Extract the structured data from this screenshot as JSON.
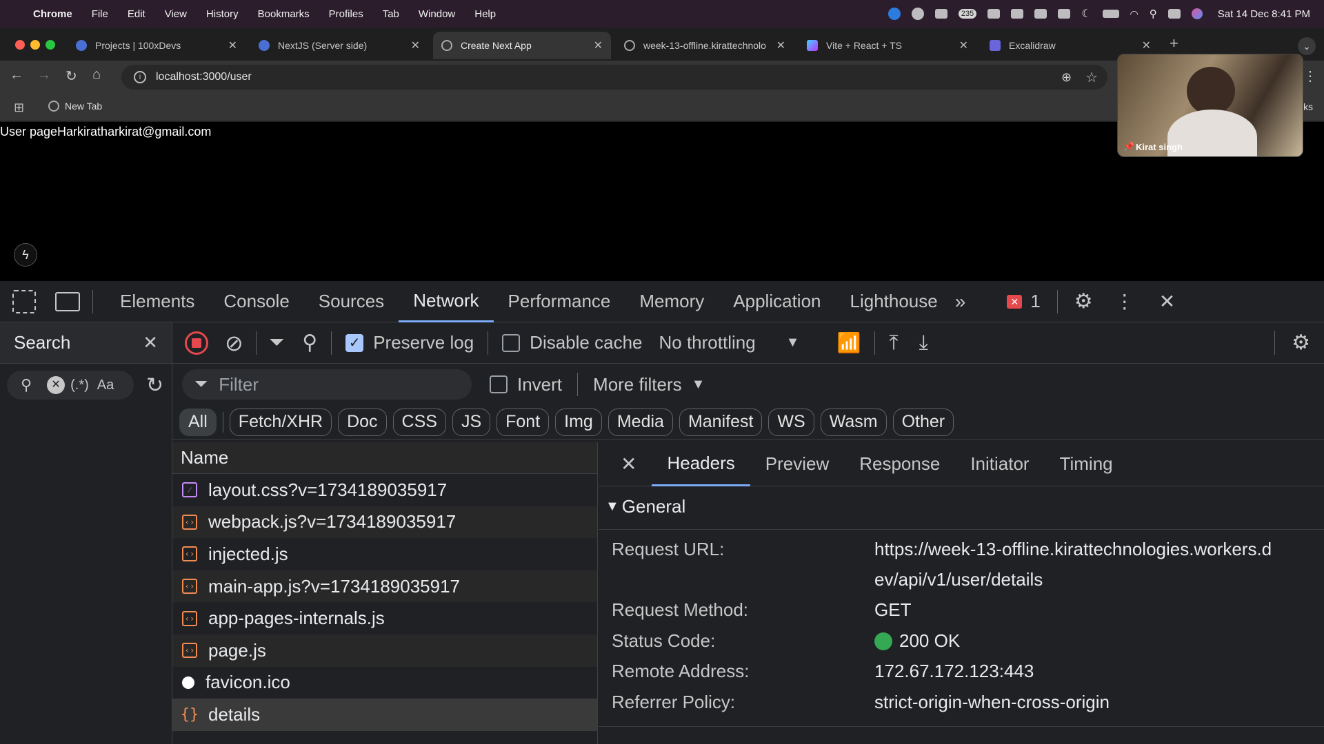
{
  "menubar": {
    "items": [
      "Chrome",
      "File",
      "Edit",
      "View",
      "History",
      "Bookmarks",
      "Profiles",
      "Tab",
      "Window",
      "Help"
    ],
    "badge_count": "235",
    "datetime": "Sat 14 Dec  8:41 PM"
  },
  "tabs": [
    {
      "title": "Projects | 100xDevs",
      "active": false
    },
    {
      "title": "NextJS (Server side)",
      "active": false
    },
    {
      "title": "Create Next App",
      "active": true
    },
    {
      "title": "week-13-offline.kirattechnolo",
      "active": false
    },
    {
      "title": "Vite + React + TS",
      "active": false
    },
    {
      "title": "Excalidraw",
      "active": false
    }
  ],
  "address": {
    "url": "localhost:3000/user"
  },
  "bookmarks": {
    "new_tab": "New Tab",
    "all_bookmarks": "ks"
  },
  "page": {
    "text": "User pageHarkiratharkirat@gmail.com"
  },
  "video": {
    "name": "Kirat singh"
  },
  "devtools": {
    "tabs": [
      "Elements",
      "Console",
      "Sources",
      "Network",
      "Performance",
      "Memory",
      "Application",
      "Lighthouse"
    ],
    "active_tab": "Network",
    "error_count": "1",
    "search_label": "Search",
    "search_regex": "(.*)",
    "search_case": "Aa",
    "preserve_log": "Preserve log",
    "disable_cache": "Disable cache",
    "throttling": "No throttling",
    "filter_placeholder": "Filter",
    "invert": "Invert",
    "more_filters": "More filters",
    "chips": [
      "All",
      "Fetch/XHR",
      "Doc",
      "CSS",
      "JS",
      "Font",
      "Img",
      "Media",
      "Manifest",
      "WS",
      "Wasm",
      "Other"
    ],
    "name_header": "Name",
    "requests": [
      {
        "name": "layout.css?v=1734189035917",
        "type": "css"
      },
      {
        "name": "webpack.js?v=1734189035917",
        "type": "js"
      },
      {
        "name": "injected.js",
        "type": "js"
      },
      {
        "name": "main-app.js?v=1734189035917",
        "type": "js"
      },
      {
        "name": "app-pages-internals.js",
        "type": "js"
      },
      {
        "name": "page.js",
        "type": "js"
      },
      {
        "name": "favicon.ico",
        "type": "ico"
      },
      {
        "name": "details",
        "type": "fetch"
      }
    ],
    "detail_tabs": [
      "Headers",
      "Preview",
      "Response",
      "Initiator",
      "Timing"
    ],
    "general_label": "General",
    "general": {
      "request_url_label": "Request URL:",
      "request_url_1": "https://week-13-offline.kirattechnologies.workers.d",
      "request_url_2": "ev/api/v1/user/details",
      "method_label": "Request Method:",
      "method": "GET",
      "status_label": "Status Code:",
      "status": "200 OK",
      "remote_label": "Remote Address:",
      "remote": "172.67.172.123:443",
      "referrer_label": "Referrer Policy:",
      "referrer": "strict-origin-when-cross-origin"
    },
    "colors": {
      "accent": "#7cacf8",
      "status_ok": "#34a853",
      "error": "#e5484d"
    }
  }
}
